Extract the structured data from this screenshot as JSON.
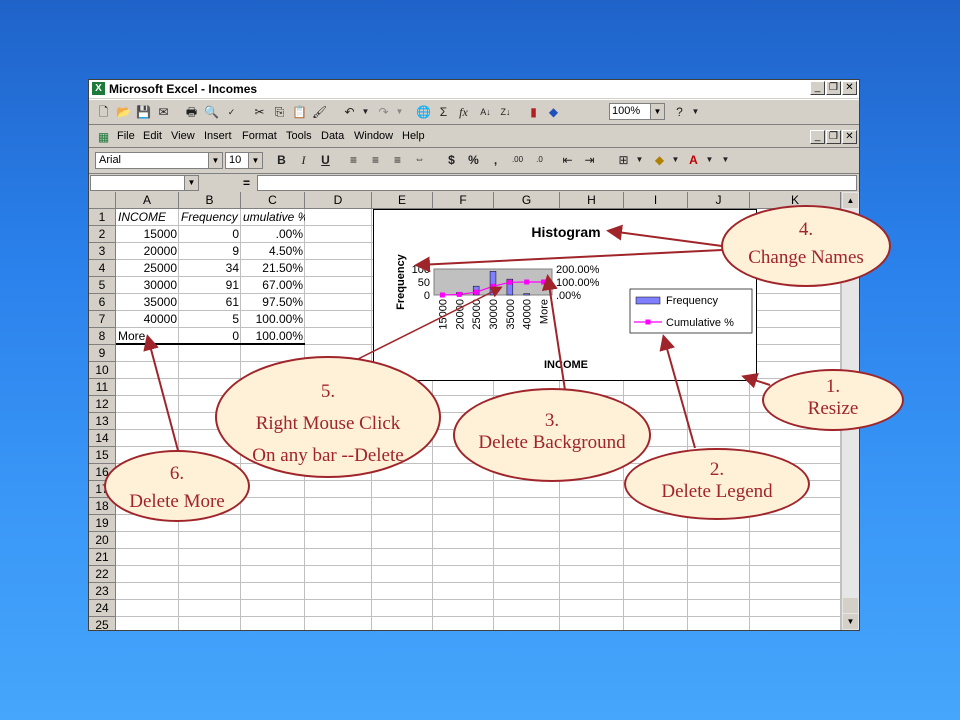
{
  "window": {
    "title": "Microsoft Excel - Incomes",
    "app_icon": "excel-icon",
    "zoom": "100%"
  },
  "menu": [
    "File",
    "Edit",
    "View",
    "Insert",
    "Format",
    "Tools",
    "Data",
    "Window",
    "Help"
  ],
  "format_bar": {
    "font": "Arial",
    "size": "10"
  },
  "formula_bar": {
    "equals": "="
  },
  "sheet": {
    "columns": [
      "A",
      "B",
      "C",
      "D",
      "E",
      "F",
      "G",
      "H",
      "I",
      "J",
      "K"
    ],
    "rows": [
      "1",
      "2",
      "3",
      "4",
      "5",
      "6",
      "7",
      "8",
      "9",
      "10",
      "11",
      "12",
      "13",
      "14",
      "15",
      "16",
      "17",
      "18",
      "19",
      "20",
      "21",
      "22",
      "23",
      "24",
      "25"
    ],
    "headers": {
      "a": "INCOME",
      "b": "Frequency",
      "c": "umulative %"
    },
    "data": [
      {
        "a": "15000",
        "b": "0",
        "c": ".00%"
      },
      {
        "a": "20000",
        "b": "9",
        "c": "4.50%"
      },
      {
        "a": "25000",
        "b": "34",
        "c": "21.50%"
      },
      {
        "a": "30000",
        "b": "91",
        "c": "67.00%"
      },
      {
        "a": "35000",
        "b": "61",
        "c": "97.50%"
      },
      {
        "a": "40000",
        "b": "5",
        "c": "100.00%"
      },
      {
        "a": "More",
        "b": "0",
        "c": "100.00%"
      }
    ]
  },
  "chart_data": {
    "type": "bar",
    "title": "Histogram",
    "xlabel": "INCOME",
    "ylabel": "Frequency",
    "categories": [
      "15000",
      "20000",
      "25000",
      "30000",
      "35000",
      "40000",
      "More"
    ],
    "series": [
      {
        "name": "Frequency",
        "type": "bar",
        "values": [
          0,
          9,
          34,
          91,
          61,
          5,
          0
        ]
      },
      {
        "name": "Cumulative %",
        "type": "line",
        "values": [
          0,
          4.5,
          21.5,
          67,
          97.5,
          100,
          100
        ]
      }
    ],
    "y_ticks": [
      "100",
      "50",
      "0"
    ],
    "y2_ticks": [
      "200.00%",
      "100.00%",
      ".00%"
    ],
    "ylim": [
      0,
      100
    ],
    "y2lim": [
      0,
      200
    ],
    "legend": "right",
    "colors": {
      "bar": "#8080ff",
      "line": "#ff00ff",
      "plot_bg": "#c0c0c0"
    }
  },
  "callouts": {
    "c1": {
      "num": "1.",
      "text": "Resize"
    },
    "c2": {
      "num": "2.",
      "text": "Delete Legend"
    },
    "c3": {
      "num": "3.",
      "text": "Delete Background"
    },
    "c4": {
      "num": "4.",
      "text": "Change Names"
    },
    "c5": {
      "num": "5.",
      "text": "Right Mouse Click",
      "text2": "On any bar --Delete"
    },
    "c6": {
      "num": "6.",
      "text": "Delete More"
    }
  },
  "colors": {
    "callout_border": "#a0252a",
    "callout_fill": "#fff0d8",
    "arrow": "#a0252a"
  }
}
